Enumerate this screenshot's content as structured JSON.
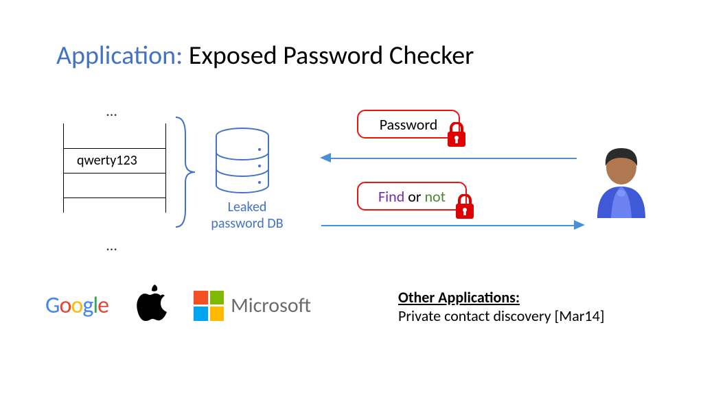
{
  "title": {
    "prefix": "Application:",
    "rest": " Exposed Password Checker"
  },
  "table": {
    "dots": "…",
    "row": "qwerty123"
  },
  "db": {
    "label_line1": "Leaked",
    "label_line2": "password DB"
  },
  "bubbles": {
    "password": "Password",
    "find": "Find",
    "or": " or ",
    "not": "not"
  },
  "logos": {
    "google": "Google",
    "microsoft": "Microsoft"
  },
  "other": {
    "heading": "Other Applications:",
    "line1": "Private contact discovery [Mar14]"
  },
  "colors": {
    "accent": "#4472c4",
    "red": "#e11",
    "find_purple": "#7030a0",
    "not_green": "#548235"
  }
}
